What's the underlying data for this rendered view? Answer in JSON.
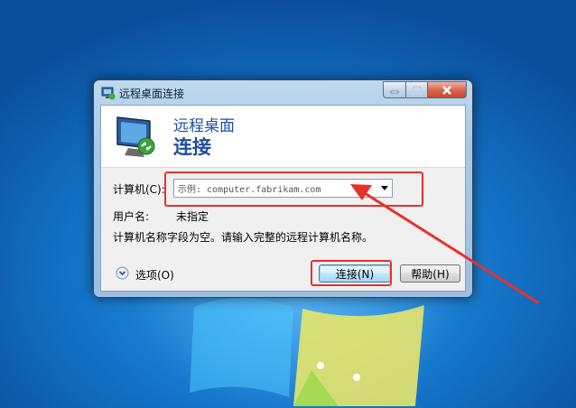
{
  "window": {
    "title": "远程桌面连接"
  },
  "header": {
    "line1": "远程桌面",
    "line2": "连接"
  },
  "form": {
    "computer_label": "计算机(C):",
    "computer_placeholder": "示例: computer.fabrikam.com",
    "username_label": "用户名:",
    "username_value": "未指定",
    "message": "计算机名称字段为空。请输入完整的远程计算机名称。"
  },
  "footer": {
    "options_label": "选项(O)",
    "connect_label": "连接(N)",
    "help_label": "帮助(H)"
  },
  "annotations": {
    "color": "#e8312a"
  },
  "icons": [
    "remote-desktop-icon",
    "minimize-icon",
    "maximize-icon",
    "close-icon",
    "monitor-icon",
    "dropdown-arrow-icon",
    "options-expand-icon"
  ]
}
